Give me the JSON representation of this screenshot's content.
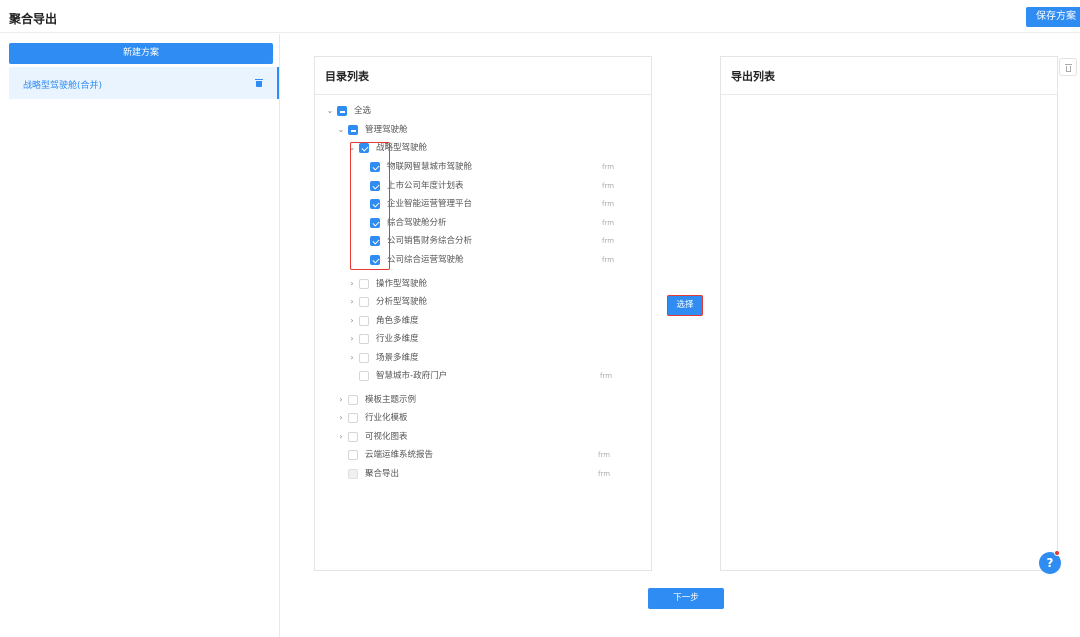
{
  "header": {
    "title": "聚合导出",
    "save_label": "保存方案"
  },
  "sidebar": {
    "new_plan_label": "新建方案",
    "plans": [
      {
        "label": "战略型驾驶舱(合并)"
      }
    ]
  },
  "directory": {
    "title": "目录列表",
    "rows": [
      {
        "label": "全选",
        "arrow": "⌄",
        "state": "indeterminate"
      },
      {
        "label": "管理驾驶舱",
        "arrow": "⌄",
        "state": "indeterminate"
      },
      {
        "label": "战略型驾驶舱",
        "arrow": "⌄",
        "state": "checked"
      },
      {
        "label": "物联网智慧城市驾驶舱",
        "state": "checked",
        "ext": "frm"
      },
      {
        "label": "上市公司年度计划表",
        "state": "checked",
        "ext": "frm"
      },
      {
        "label": "企业智能运营管理平台",
        "state": "checked",
        "ext": "frm"
      },
      {
        "label": "综合驾驶舱分析",
        "state": "checked",
        "ext": "frm"
      },
      {
        "label": "公司销售财务综合分析",
        "state": "checked",
        "ext": "frm"
      },
      {
        "label": "公司综合运营驾驶舱",
        "state": "checked",
        "ext": "frm"
      },
      {
        "label": "操作型驾驶舱",
        "arrow": "›",
        "state": "unchecked"
      },
      {
        "label": "分析型驾驶舱",
        "arrow": "›",
        "state": "unchecked"
      },
      {
        "label": "角色多维度",
        "arrow": "›",
        "state": "unchecked"
      },
      {
        "label": "行业多维度",
        "arrow": "›",
        "state": "unchecked"
      },
      {
        "label": "场景多维度",
        "arrow": "›",
        "state": "unchecked"
      },
      {
        "label": "智慧城市-政府门户",
        "state": "unchecked",
        "ext": "frm"
      },
      {
        "label": "模板主题示例",
        "arrow": "›",
        "state": "unchecked"
      },
      {
        "label": "行业化模板",
        "arrow": "›",
        "state": "unchecked"
      },
      {
        "label": "可视化图表",
        "arrow": "›",
        "state": "unchecked"
      },
      {
        "label": "云端运维系统报告",
        "state": "unchecked",
        "ext": "frm"
      },
      {
        "label": "聚合导出",
        "state": "disabled",
        "ext": "frm"
      }
    ]
  },
  "export_list": {
    "title": "导出列表"
  },
  "actions": {
    "select_label": "选择",
    "next_label": "下一步",
    "help_label": "?"
  },
  "colors": {
    "accent": "#2f8cf2",
    "highlight": "#e53935"
  }
}
